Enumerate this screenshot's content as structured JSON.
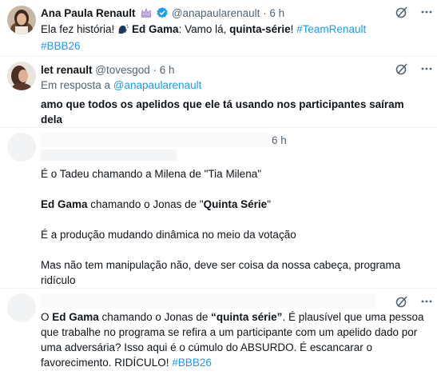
{
  "post1": {
    "author_name": "Ana Paula Renault",
    "handle": "@anapaularenault",
    "time": "· 6 h",
    "text_intro": "Ela fez história! ",
    "text_name": "Ed Gama",
    "text_mid": ": Vamo lá, ",
    "text_bold2": "quinta-série",
    "text_end": "! ",
    "hashtag1": "#TeamRenault",
    "hashtag2": "#BBB26"
  },
  "post2": {
    "author_name": "let renault",
    "handle": "@tovesgod",
    "time": "· 6 h",
    "reply_prefix": "Em resposta a ",
    "reply_handle": "@anapaularenault",
    "text": "amo que todos os apelidos que ele tá usando nos participantes saíram dela"
  },
  "post3": {
    "time_fragment": "6 h",
    "para1": "É o Tadeu chamando a Milena de \"Tia Milena\"",
    "para2_name": "Ed Gama",
    "para2_mid": " chamando o Jonas de \"",
    "para2_bold": "Quinta Série",
    "para2_end": "\"",
    "para3": "É a produção mudando dinâmica no meio da votação",
    "para4": "Mas não tem manipulação não, deve ser coisa da nossa cabeça, programa ridículo"
  },
  "post4": {
    "t_start": "O ",
    "t_name": "Ed Gama",
    "t_mid": " chamando o Jonas de ",
    "t_bold": "“quinta série”",
    "t_rest": ". É plausível que uma pessoa que trabalhe no programa se refira a um participante com um apelido dado por uma adversária? Isso aqui é o cúmulo do ABSURDO. É escancarar o favorecimento. RIDÍCULO! ",
    "hashtag": "#BBB26"
  },
  "colors": {
    "accent": "#1d9bf0",
    "muted": "#536471",
    "divider": "#eff3f4",
    "verified": "#1d9bf0"
  },
  "icons": [
    "grok-icon",
    "more-icon",
    "verified-badge-icon",
    "crown-emoji-icon",
    "speaking-head-emoji-icon"
  ]
}
